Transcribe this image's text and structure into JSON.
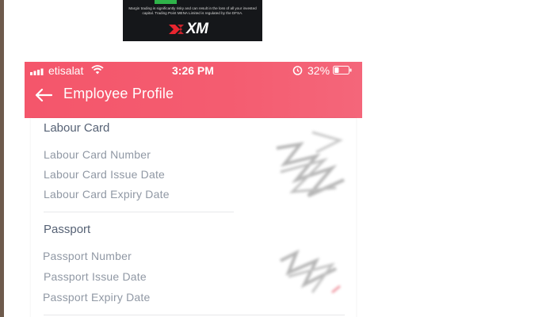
{
  "ad": {
    "text": "Margin trading is significantly risky and can result in the loss of all your invested capital. Trading Point MENA Limited is regulated by the DFSA.",
    "logo": "XM"
  },
  "status_bar": {
    "carrier": "etisalat",
    "time": "3:26 PM",
    "battery_percent": "32%",
    "battery_level": 0.32,
    "icons": [
      "signal-icon",
      "wifi-icon",
      "alarm-icon",
      "battery-icon"
    ]
  },
  "header": {
    "title": "Employee Profile",
    "back_icon": "back-arrow-icon"
  },
  "sections": [
    {
      "title": "Labour Card",
      "rows": [
        {
          "label": "Labour Card Number"
        },
        {
          "label": "Labour Card Issue Date"
        },
        {
          "label": "Labour Card Expiry Date"
        }
      ]
    },
    {
      "title": "Passport",
      "rows": [
        {
          "label": "Passport Number"
        },
        {
          "label": "Passport Issue Date"
        },
        {
          "label": "Passport Expiry Date"
        }
      ]
    }
  ],
  "colors": {
    "header": "#f45c70",
    "section_title": "#566275",
    "row_label": "#9098a4"
  }
}
